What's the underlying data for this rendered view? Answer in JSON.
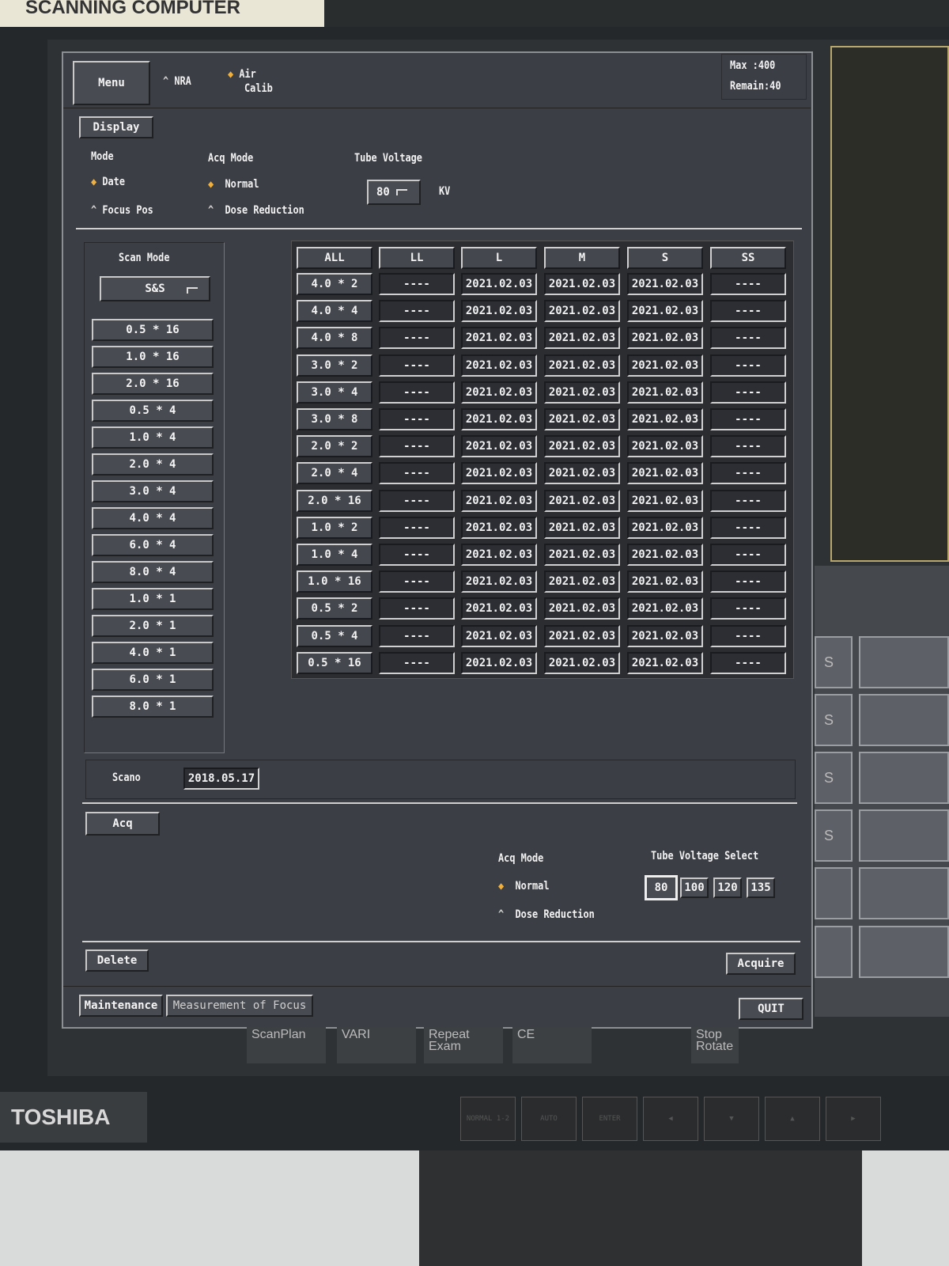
{
  "sticker": "SCANNING COMPUTER",
  "brand": "TOSHIBA",
  "header": {
    "menu": "Menu",
    "nra": "NRA",
    "air_calib_1": "Air",
    "air_calib_2": "Calib",
    "max": "Max   :400",
    "remain": "Remain:40"
  },
  "display": {
    "button": "Display",
    "mode_label": "Mode",
    "mode_options": [
      "Date",
      "Focus Pos"
    ],
    "mode_selected": "Date",
    "acq_mode_label": "Acq Mode",
    "acq_options": [
      "Normal",
      "Dose Reduction"
    ],
    "acq_selected": "Normal",
    "tube_voltage_label": "Tube Voltage",
    "tube_voltage_value": "80",
    "tube_voltage_unit": "KV"
  },
  "scan_mode": {
    "label": "Scan Mode",
    "select_value": "S&S",
    "items": [
      "0.5 * 16",
      "1.0 * 16",
      "2.0 * 16",
      "0.5 * 4",
      "1.0 * 4",
      "2.0 * 4",
      "3.0 * 4",
      "4.0 * 4",
      "6.0 * 4",
      "8.0 * 4",
      "1.0 * 1",
      "2.0 * 1",
      "4.0 * 1",
      "6.0 * 1",
      "8.0 * 1"
    ]
  },
  "table": {
    "headers": [
      "ALL",
      "LL",
      "L",
      "M",
      "S",
      "SS"
    ],
    "rows": [
      [
        "4.0 * 2",
        "----",
        "2021.02.03",
        "2021.02.03",
        "2021.02.03",
        "----"
      ],
      [
        "4.0 * 4",
        "----",
        "2021.02.03",
        "2021.02.03",
        "2021.02.03",
        "----"
      ],
      [
        "4.0 * 8",
        "----",
        "2021.02.03",
        "2021.02.03",
        "2021.02.03",
        "----"
      ],
      [
        "3.0 * 2",
        "----",
        "2021.02.03",
        "2021.02.03",
        "2021.02.03",
        "----"
      ],
      [
        "3.0 * 4",
        "----",
        "2021.02.03",
        "2021.02.03",
        "2021.02.03",
        "----"
      ],
      [
        "3.0 * 8",
        "----",
        "2021.02.03",
        "2021.02.03",
        "2021.02.03",
        "----"
      ],
      [
        "2.0 * 2",
        "----",
        "2021.02.03",
        "2021.02.03",
        "2021.02.03",
        "----"
      ],
      [
        "2.0 * 4",
        "----",
        "2021.02.03",
        "2021.02.03",
        "2021.02.03",
        "----"
      ],
      [
        "2.0 * 16",
        "----",
        "2021.02.03",
        "2021.02.03",
        "2021.02.03",
        "----"
      ],
      [
        "1.0 * 2",
        "----",
        "2021.02.03",
        "2021.02.03",
        "2021.02.03",
        "----"
      ],
      [
        "1.0 * 4",
        "----",
        "2021.02.03",
        "2021.02.03",
        "2021.02.03",
        "----"
      ],
      [
        "1.0 * 16",
        "----",
        "2021.02.03",
        "2021.02.03",
        "2021.02.03",
        "----"
      ],
      [
        "0.5 * 2",
        "----",
        "2021.02.03",
        "2021.02.03",
        "2021.02.03",
        "----"
      ],
      [
        "0.5 * 4",
        "----",
        "2021.02.03",
        "2021.02.03",
        "2021.02.03",
        "----"
      ],
      [
        "0.5 * 16",
        "----",
        "2021.02.03",
        "2021.02.03",
        "2021.02.03",
        "----"
      ]
    ]
  },
  "scano": {
    "label": "Scano",
    "value": "2018.05.17"
  },
  "acq": {
    "button": "Acq",
    "acq_mode_label": "Acq Mode",
    "acq_options": [
      "Normal",
      "Dose Reduction"
    ],
    "acq_selected": "Normal",
    "tube_voltage_select_label": "Tube Voltage Select",
    "voltages": [
      "80",
      "100",
      "120",
      "135"
    ],
    "voltage_selected": "80"
  },
  "actions": {
    "delete": "Delete",
    "acquire": "Acquire",
    "maintenance": "Maintenance",
    "measurement": "Measurement of Focus",
    "quit": "QUIT"
  },
  "right_panel": {
    "s_labels": [
      "S",
      "S",
      "S",
      "S"
    ]
  },
  "toolbar": {
    "scanplan": "ScanPlan",
    "vari": "VARI",
    "repeat_exam": "Repeat Exam",
    "ce": "CE",
    "stop_rotate": "Stop Rotate"
  },
  "keys": [
    "NORMAL 1-2",
    "AUTO",
    "ENTER",
    "◀",
    "▼",
    "▲",
    "▶"
  ],
  "colors": {
    "accent": "#f0b040",
    "panel": "#3b3e44"
  }
}
